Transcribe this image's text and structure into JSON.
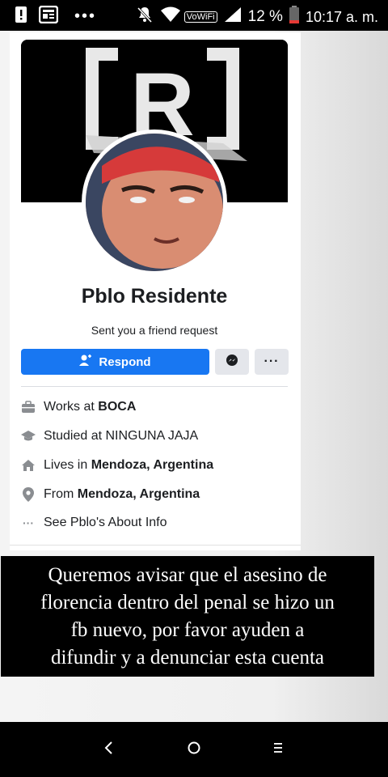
{
  "status_bar": {
    "battery_percent": "12 %",
    "time": "10:17 a. m.",
    "wifi_label": "VoWiFi",
    "icons": [
      "alert-icon",
      "news-icon",
      "more-dots-icon",
      "mute-icon",
      "wifi-icon",
      "signal-icon",
      "battery-icon"
    ]
  },
  "cover": {
    "logo_letter": "R"
  },
  "profile": {
    "name": "Pblo Residente",
    "subtitle": "Sent you a friend request"
  },
  "actions": {
    "respond_label": "Respond",
    "more_label": "···"
  },
  "info": [
    {
      "icon": "briefcase-icon",
      "prefix": "Works at ",
      "value": "BOCA"
    },
    {
      "icon": "graduation-cap-icon",
      "prefix": "Studied at NINGUNA JAJA",
      "value": ""
    },
    {
      "icon": "home-icon",
      "prefix": "Lives in ",
      "value": "Mendoza, Argentina"
    },
    {
      "icon": "location-pin-icon",
      "prefix": "From ",
      "value": "Mendoza, Argentina"
    },
    {
      "icon": "ellipsis-icon",
      "prefix": "See Pblo's About Info",
      "value": ""
    }
  ],
  "caption": {
    "text": "Queremos avisar que el asesino de\nflorencia dentro del penal se hizo un\nfb nuevo, por favor ayuden a\ndifundir y a denunciar esta cuenta"
  },
  "colors": {
    "facebook_blue": "#1877f2",
    "button_grey": "#e4e6eb",
    "text": "#1c1e21"
  }
}
